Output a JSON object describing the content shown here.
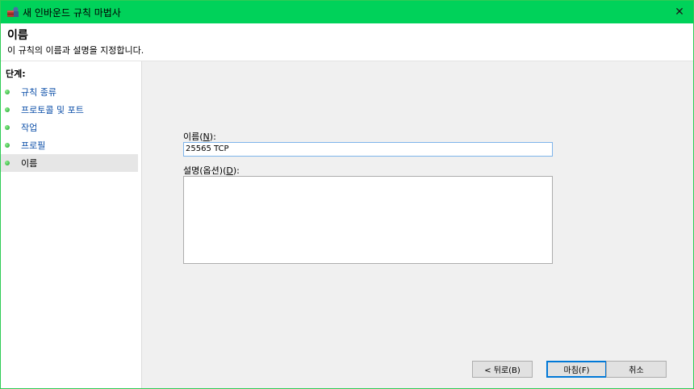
{
  "window": {
    "title": "새 인바운드 규칙 마법사",
    "close_glyph": "✕"
  },
  "header": {
    "title": "이름",
    "subtitle": "이 규칙의 이름과 설명을 지정합니다."
  },
  "steps": {
    "heading": "단계:",
    "items": [
      {
        "label": "규칙 종류"
      },
      {
        "label": "프로토콜 및 포트"
      },
      {
        "label": "작업"
      },
      {
        "label": "프로필"
      },
      {
        "label": "이름",
        "selected": true
      }
    ]
  },
  "form": {
    "name_label_prefix": "이름(",
    "name_label_key": "N",
    "name_label_suffix": "):",
    "name_value": "25565 TCP",
    "desc_label_prefix": "설명(옵션)(",
    "desc_label_key": "D",
    "desc_label_suffix": "):",
    "desc_value": ""
  },
  "buttons": {
    "back": "< 뒤로(B)",
    "finish": "마침(F)",
    "cancel": "취소"
  },
  "colors": {
    "titlebar": "#00d25a",
    "step_link": "#0b4ea8",
    "primary_border": "#0078d7"
  }
}
